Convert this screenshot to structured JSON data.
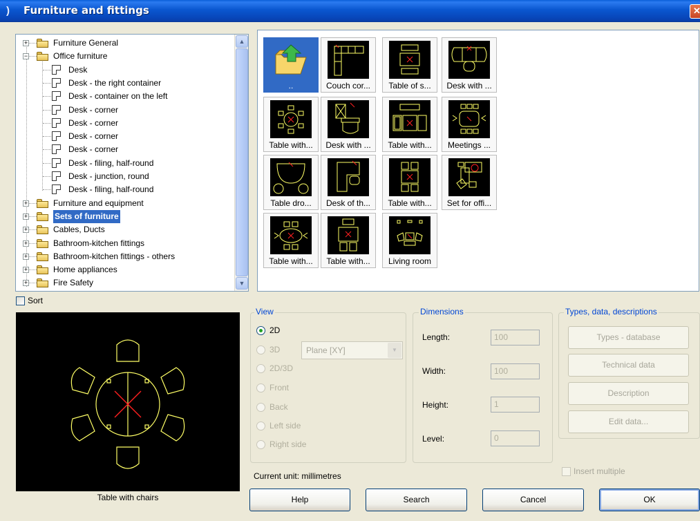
{
  "window": {
    "title": "Furniture and fittings",
    "close_glyph": "✕"
  },
  "tree": {
    "items": [
      {
        "label": "Furniture General",
        "level": 0,
        "kind": "folder",
        "expander": "+"
      },
      {
        "label": "Office furniture",
        "level": 0,
        "kind": "folder",
        "expander": "−"
      },
      {
        "label": "Desk",
        "level": 1,
        "kind": "doc"
      },
      {
        "label": "Desk - the right container",
        "level": 1,
        "kind": "doc"
      },
      {
        "label": "Desk - container on the left",
        "level": 1,
        "kind": "doc"
      },
      {
        "label": "Desk - corner",
        "level": 1,
        "kind": "doc"
      },
      {
        "label": "Desk - corner",
        "level": 1,
        "kind": "doc"
      },
      {
        "label": "Desk - corner",
        "level": 1,
        "kind": "doc"
      },
      {
        "label": "Desk - corner",
        "level": 1,
        "kind": "doc"
      },
      {
        "label": "Desk - filing, half-round",
        "level": 1,
        "kind": "doc"
      },
      {
        "label": "Desk - junction, round",
        "level": 1,
        "kind": "doc"
      },
      {
        "label": "Desk - filing, half-round",
        "level": 1,
        "kind": "doc"
      },
      {
        "label": "Furniture and equipment",
        "level": 0,
        "kind": "folder",
        "expander": "+"
      },
      {
        "label": "Sets of furniture",
        "level": 0,
        "kind": "folder-open",
        "expander": "+",
        "selected": true
      },
      {
        "label": "Cables, Ducts",
        "level": 0,
        "kind": "folder",
        "expander": "+"
      },
      {
        "label": "Bathroom-kitchen fittings",
        "level": 0,
        "kind": "folder",
        "expander": "+"
      },
      {
        "label": "Bathroom-kitchen fittings - others",
        "level": 0,
        "kind": "folder",
        "expander": "+"
      },
      {
        "label": "Home appliances",
        "level": 0,
        "kind": "folder",
        "expander": "+"
      },
      {
        "label": "Fire Safety",
        "level": 0,
        "kind": "folder",
        "expander": "+"
      }
    ],
    "scroll_up": "▲",
    "scroll_down": "▼"
  },
  "grid": {
    "tiles": [
      {
        "label": "..",
        "icon": "folder-up-icon",
        "selected": true
      },
      {
        "label": "Couch cor...",
        "icon": "couch-corner-icon"
      },
      {
        "label": "Table of s...",
        "icon": "table-icon"
      },
      {
        "label": "Desk with ...",
        "icon": "desk-icon"
      },
      {
        "label": "Table with...",
        "icon": "round-table-chairs-icon"
      },
      {
        "label": "Desk with ...",
        "icon": "desk-chair-icon"
      },
      {
        "label": "Table with...",
        "icon": "table-sofas-icon"
      },
      {
        "label": "Meetings ...",
        "icon": "meeting-table-icon"
      },
      {
        "label": "Table dro...",
        "icon": "table-drop-icon"
      },
      {
        "label": "Desk of th...",
        "icon": "desk-corner-icon"
      },
      {
        "label": "Table with...",
        "icon": "table-two-chairs-icon"
      },
      {
        "label": "Set for offi...",
        "icon": "office-set-icon"
      },
      {
        "label": "Table with...",
        "icon": "oval-table-icon"
      },
      {
        "label": "Table with...",
        "icon": "table-square-icon"
      },
      {
        "label": "Living room",
        "icon": "living-room-icon"
      }
    ]
  },
  "sort": {
    "label": "Sort",
    "checked": false
  },
  "preview": {
    "caption": "Table with chairs"
  },
  "view": {
    "title": "View",
    "options": [
      {
        "label": "2D",
        "checked": true,
        "enabled": true
      },
      {
        "label": "3D",
        "checked": false,
        "enabled": false
      },
      {
        "label": "2D/3D",
        "checked": false,
        "enabled": false
      },
      {
        "label": "Front",
        "checked": false,
        "enabled": false
      },
      {
        "label": "Back",
        "checked": false,
        "enabled": false
      },
      {
        "label": "Left side",
        "checked": false,
        "enabled": false
      },
      {
        "label": "Right side",
        "checked": false,
        "enabled": false
      }
    ],
    "plane_value": "Plane  [XY]"
  },
  "dimensions": {
    "title": "Dimensions",
    "length_label": "Length:",
    "length_value": "100",
    "width_label": "Width:",
    "width_value": "100",
    "height_label": "Height:",
    "height_value": "1",
    "level_label": "Level:",
    "level_value": "0"
  },
  "types": {
    "title": "Types, data, descriptions",
    "types_database": "Types - database",
    "technical_data": "Technical data",
    "description": "Description",
    "edit_data": "Edit data..."
  },
  "insert_multiple": {
    "label": "Insert multiple",
    "checked": false
  },
  "current_unit": "Current unit: millimetres",
  "buttons": {
    "help": "Help",
    "search": "Search",
    "cancel": "Cancel",
    "ok": "OK"
  },
  "colors": {
    "title_bar": "#0a57d0",
    "selection": "#316ac5",
    "cad_line": "#ffff66",
    "cad_mark": "#ff2020",
    "dialog_bg": "#ece9d8"
  }
}
